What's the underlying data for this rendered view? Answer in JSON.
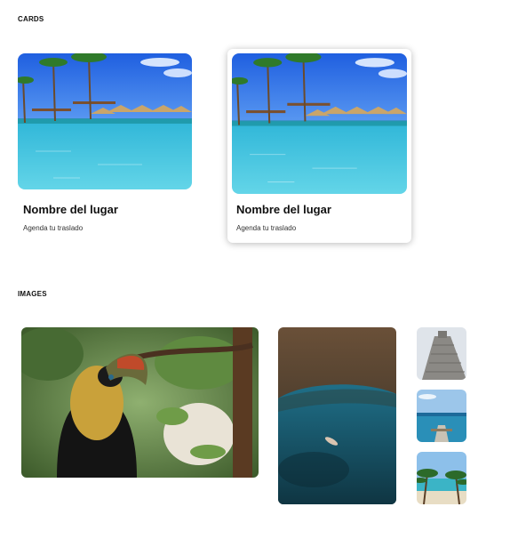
{
  "sections": {
    "cards_label": "CARDS",
    "images_label": "IMAGES"
  },
  "cards": [
    {
      "title": "Nombre del lugar",
      "subtitle": "Agenda tu traslado",
      "state": "default"
    },
    {
      "title": "Nombre del lugar",
      "subtitle": "Agenda tu traslado",
      "state": "hover"
    }
  ],
  "images": [
    {
      "subject": "toucan"
    },
    {
      "subject": "cenote-swimmer"
    },
    {
      "subject": "mayan-pyramid"
    },
    {
      "subject": "beach-pier"
    },
    {
      "subject": "palm-beach"
    }
  ],
  "colors": {
    "sky": "#2a6ee8",
    "water": "#3fc7e0",
    "card_shadow": "rgba(0,0,0,0.28)"
  }
}
